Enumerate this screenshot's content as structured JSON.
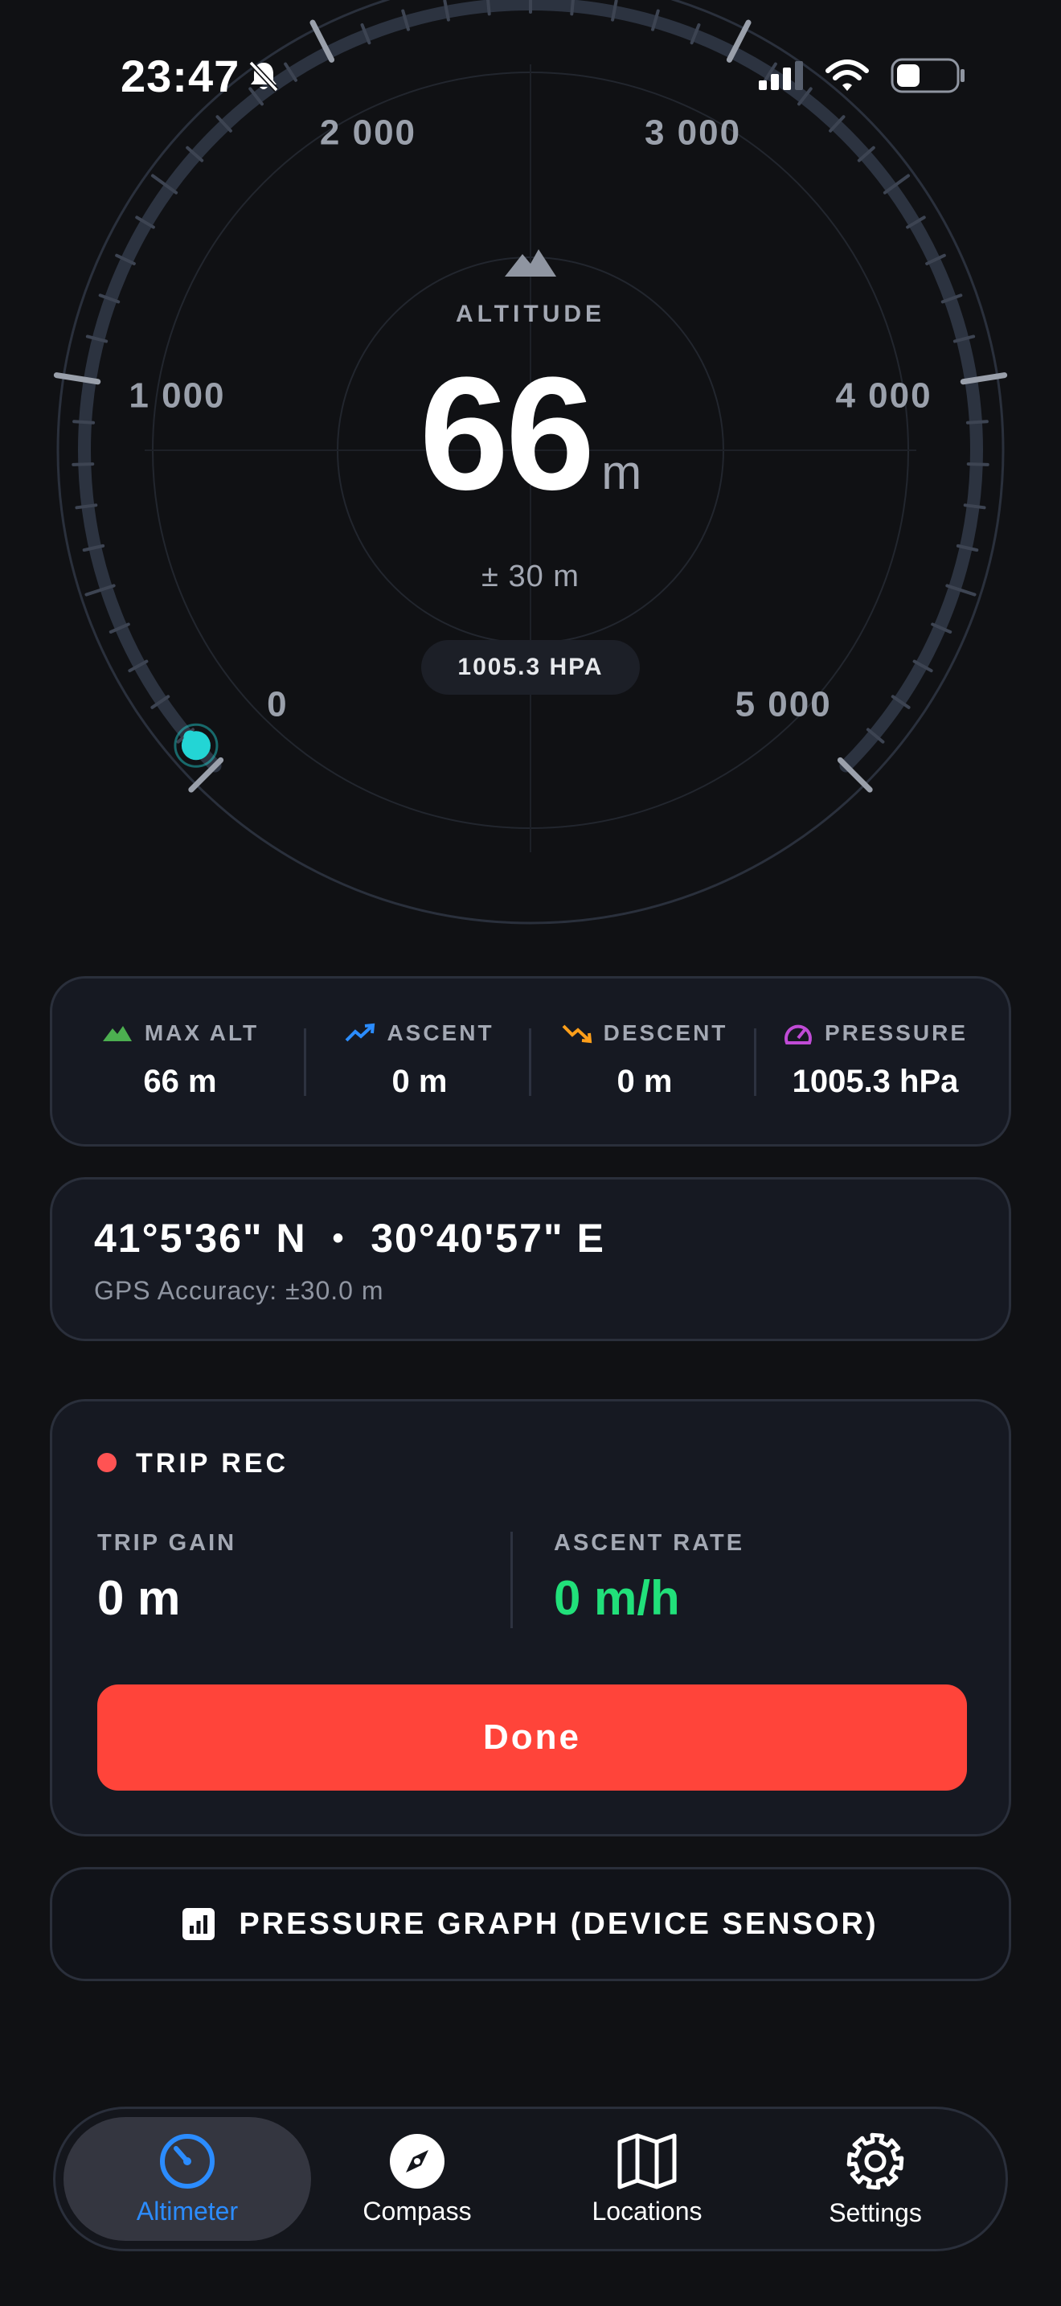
{
  "status_bar": {
    "time": "23:47"
  },
  "gauge": {
    "label": "ALTITUDE",
    "value": "66",
    "unit": "m",
    "accuracy": "± 30 m",
    "pressure_badge": "1005.3 HPA",
    "scale_labels": [
      "0",
      "1 000",
      "2 000",
      "3 000",
      "4 000",
      "5 000"
    ],
    "scale_min": 0,
    "scale_max": 5000,
    "current_value": 66,
    "accent_color": "#23d5d5",
    "track_color": "#2c3340"
  },
  "stats": [
    {
      "label": "MAX ALT",
      "value": "66 m",
      "icon": "mountain-icon",
      "color": "#4caf50"
    },
    {
      "label": "ASCENT",
      "value": "0 m",
      "icon": "trend-up-icon",
      "color": "#2b8cff"
    },
    {
      "label": "DESCENT",
      "value": "0 m",
      "icon": "trend-down-icon",
      "color": "#ff9f1a"
    },
    {
      "label": "PRESSURE",
      "value": "1005.3 hPa",
      "icon": "gauge-icon",
      "color": "#c04bd6"
    }
  ],
  "location": {
    "lat": "41°5'36\" N",
    "separator": "•",
    "lon": "30°40'57\" E",
    "accuracy": "GPS Accuracy: ±30.0 m"
  },
  "trip": {
    "title": "TRIP REC",
    "gain_label": "TRIP GAIN",
    "gain_value": "0 m",
    "rate_label": "ASCENT RATE",
    "rate_value": "0 m/h",
    "rate_color": "#21e07a",
    "done_label": "Done",
    "done_color": "#ff443a"
  },
  "graph_button": {
    "label": "PRESSURE GRAPH (DEVICE SENSOR)",
    "icon": "bar-chart-icon"
  },
  "tabs": [
    {
      "label": "Altimeter",
      "icon": "altimeter-icon",
      "active": true
    },
    {
      "label": "Compass",
      "icon": "compass-icon",
      "active": false
    },
    {
      "label": "Locations",
      "icon": "map-icon",
      "active": false
    },
    {
      "label": "Settings",
      "icon": "gear-icon",
      "active": false
    }
  ]
}
